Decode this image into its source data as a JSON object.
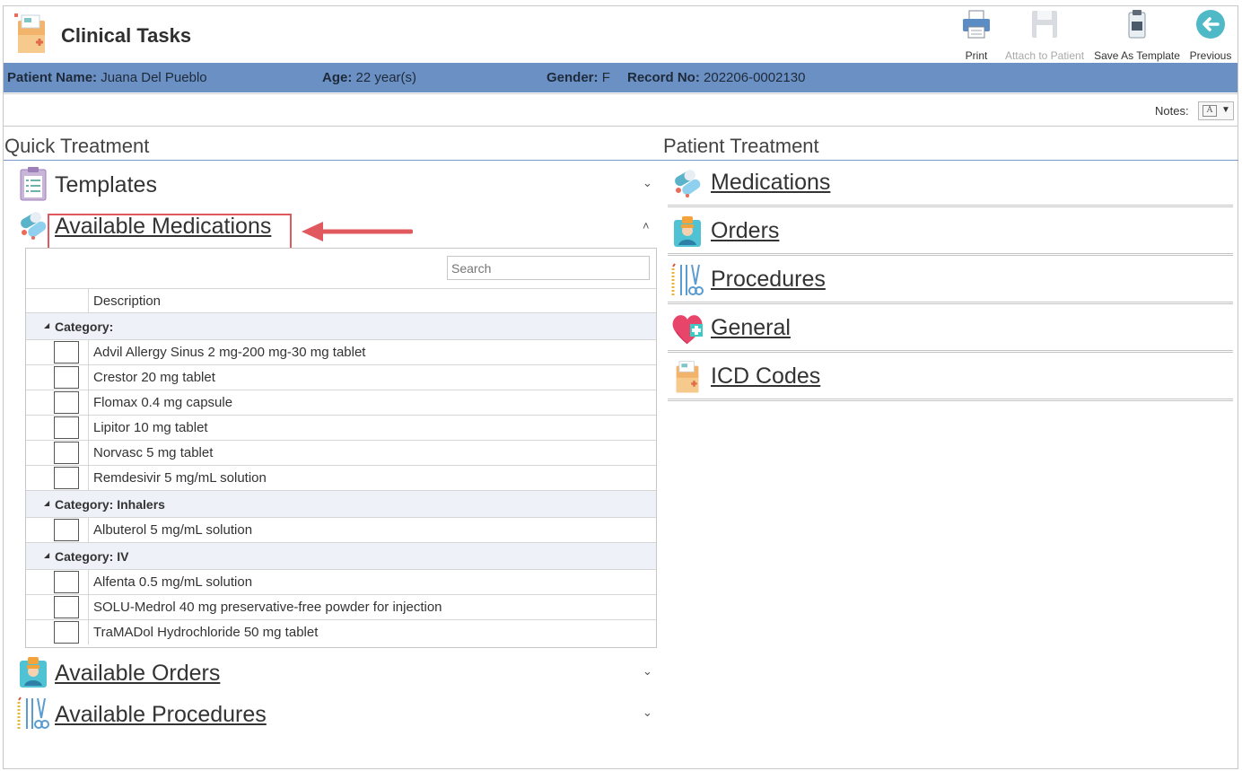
{
  "app": {
    "title": "Clinical Tasks"
  },
  "toolbar": {
    "print": "Print",
    "attach": "Attach to Patient",
    "save_template": "Save As Template",
    "previous": "Previous"
  },
  "patient": {
    "name_label": "Patient Name:",
    "name": "Juana Del Pueblo",
    "age_label": "Age:",
    "age": "22 year(s)",
    "gender_label": "Gender:",
    "gender": "F",
    "record_label": "Record No:",
    "record": "202206-0002130"
  },
  "notes": {
    "label": "Notes:"
  },
  "quick_treatment": {
    "heading": "Quick Treatment",
    "templates": "Templates",
    "available_medications": "Available Medications",
    "available_orders": "Available Orders",
    "available_procedures": "Available Procedures"
  },
  "grid": {
    "search_placeholder": "Search",
    "column_description": "Description",
    "groups": [
      {
        "label": "Category:",
        "items": [
          "Advil Allergy Sinus 2 mg-200 mg-30 mg tablet",
          "Crestor 20 mg tablet",
          "Flomax 0.4 mg capsule",
          "Lipitor 10 mg tablet",
          "Norvasc 5 mg tablet",
          "Remdesivir 5 mg/mL solution"
        ]
      },
      {
        "label": "Category: Inhalers",
        "items": [
          "Albuterol 5 mg/mL solution"
        ]
      },
      {
        "label": "Category: IV",
        "items": [
          "Alfenta 0.5 mg/mL solution",
          "SOLU-Medrol 40 mg preservative-free powder for injection",
          "TraMADol Hydrochloride 50 mg tablet"
        ]
      }
    ]
  },
  "patient_treatment": {
    "heading": "Patient Treatment",
    "medications": "Medications",
    "orders": "Orders",
    "procedures": "Procedures",
    "general": "General",
    "icd_codes": "ICD Codes"
  },
  "colors": {
    "patient_bar": "#6b90c4",
    "highlight": "#e0595e",
    "section_line": "#7a98c8"
  },
  "icons": {
    "logo": "clinical-folder-icon",
    "print": "printer-icon",
    "attach": "floppy-disk-icon",
    "save_template": "clipboard-icon",
    "previous": "back-arrow-icon"
  }
}
